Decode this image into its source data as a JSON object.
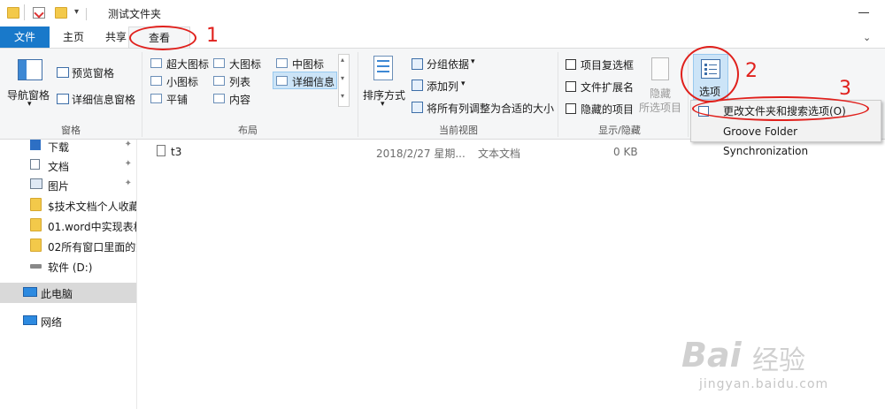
{
  "window": {
    "title": "测试文件夹"
  },
  "tabs": [
    {
      "label": "文件"
    },
    {
      "label": "主页"
    },
    {
      "label": "共享"
    },
    {
      "label": "查看"
    }
  ],
  "ribbon": {
    "panes": {
      "nav_pane": "导航窗格",
      "preview_pane": "预览窗格",
      "details_pane": "详细信息窗格",
      "group_label": "窗格"
    },
    "layout": {
      "items": [
        "超大图标",
        "大图标",
        "中图标",
        "小图标",
        "列表",
        "详细信息",
        "平铺",
        "内容"
      ],
      "group_label": "布局"
    },
    "current_view": {
      "sort_by": "排序方式",
      "group_by": "分组依据",
      "add_columns": "添加列",
      "size_all_columns": "将所有列调整为合适的大小",
      "group_label": "当前视图"
    },
    "show_hide": {
      "item_checkboxes": "项目复选框",
      "file_extensions": "文件扩展名",
      "hidden_items": "隐藏的项目",
      "hide_selected_1": "隐藏",
      "hide_selected_2": "所选项目",
      "group_label": "显示/隐藏"
    },
    "options": {
      "label": "选项"
    }
  },
  "dropdown": {
    "items": [
      "更改文件夹和搜索选项(O)",
      "Groove Folder Synchronization"
    ]
  },
  "nav_items": [
    {
      "label": "下载",
      "pinned": true
    },
    {
      "label": "文档",
      "pinned": true
    },
    {
      "label": "图片",
      "pinned": true
    },
    {
      "label": "$技术文档个人收藏"
    },
    {
      "label": "01.word中实现表格"
    },
    {
      "label": "02所有窗口里面的文"
    },
    {
      "label": "软件 (D:)"
    },
    {
      "label": "此电脑"
    },
    {
      "label": "网络"
    }
  ],
  "files": [
    {
      "name": "t3",
      "date": "2018/2/27 星期...",
      "type": "文本文档",
      "size": "0 KB"
    }
  ],
  "annotations": {
    "step1": "1",
    "step2": "2",
    "step3": "3"
  },
  "watermark": {
    "brand": "Bai",
    "brand_cn": "经验",
    "url": "jingyan.baidu.com"
  },
  "colors": {
    "file_tab": "#1979ca",
    "annotation_red": "#e0201c",
    "desktop_bg": "#1e3d8c"
  }
}
